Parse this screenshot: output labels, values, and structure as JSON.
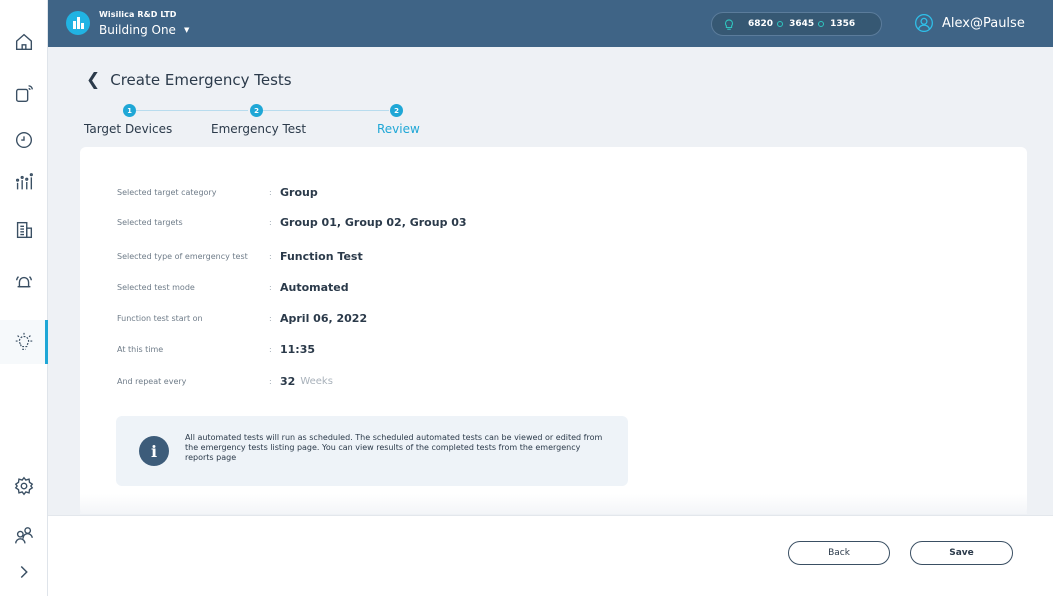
{
  "header": {
    "org_name": "Wisilica R&D LTD",
    "building_name": "Building One",
    "stats": [
      "6820",
      "3645",
      "1356"
    ],
    "user_name": "Alex@Paulse"
  },
  "page": {
    "title": "Create Emergency Tests"
  },
  "stepper": [
    {
      "number": "1",
      "label": "Target Devices"
    },
    {
      "number": "2",
      "label": "Emergency Test"
    },
    {
      "number": "2",
      "label": "Review"
    }
  ],
  "review": [
    {
      "label": "Selected target category",
      "value": "Group"
    },
    {
      "label": "Selected targets",
      "value": "Group 01, Group 02, Group 03"
    },
    {
      "label": "Selected type of emergency test",
      "value": "Function Test"
    },
    {
      "label": "Selected test mode",
      "value": "Automated"
    },
    {
      "label": "Function test start on",
      "value": "April 06, 2022"
    },
    {
      "label": "At this time",
      "value": "11:35"
    },
    {
      "label": "And repeat every",
      "value": "32",
      "unit": "Weeks"
    }
  ],
  "info": {
    "text": "All automated tests will run as scheduled. The scheduled automated tests can be viewed or edited from the emergency tests listing page. You can view results of the completed tests from the emergency reports page"
  },
  "footer": {
    "back_label": "Back",
    "save_label": "Save"
  },
  "icons": {
    "sidebar": [
      "home-icon",
      "device-icon",
      "clock-icon",
      "analytics-icon",
      "building-icon",
      "alert-bell-icon",
      "emergency-bulb-icon",
      "settings-icon",
      "users-icon",
      "expand-icon"
    ]
  },
  "colors": {
    "header_bg": "#3f6486",
    "accent": "#1fa7d6",
    "info_bg": "#eef3f8"
  }
}
